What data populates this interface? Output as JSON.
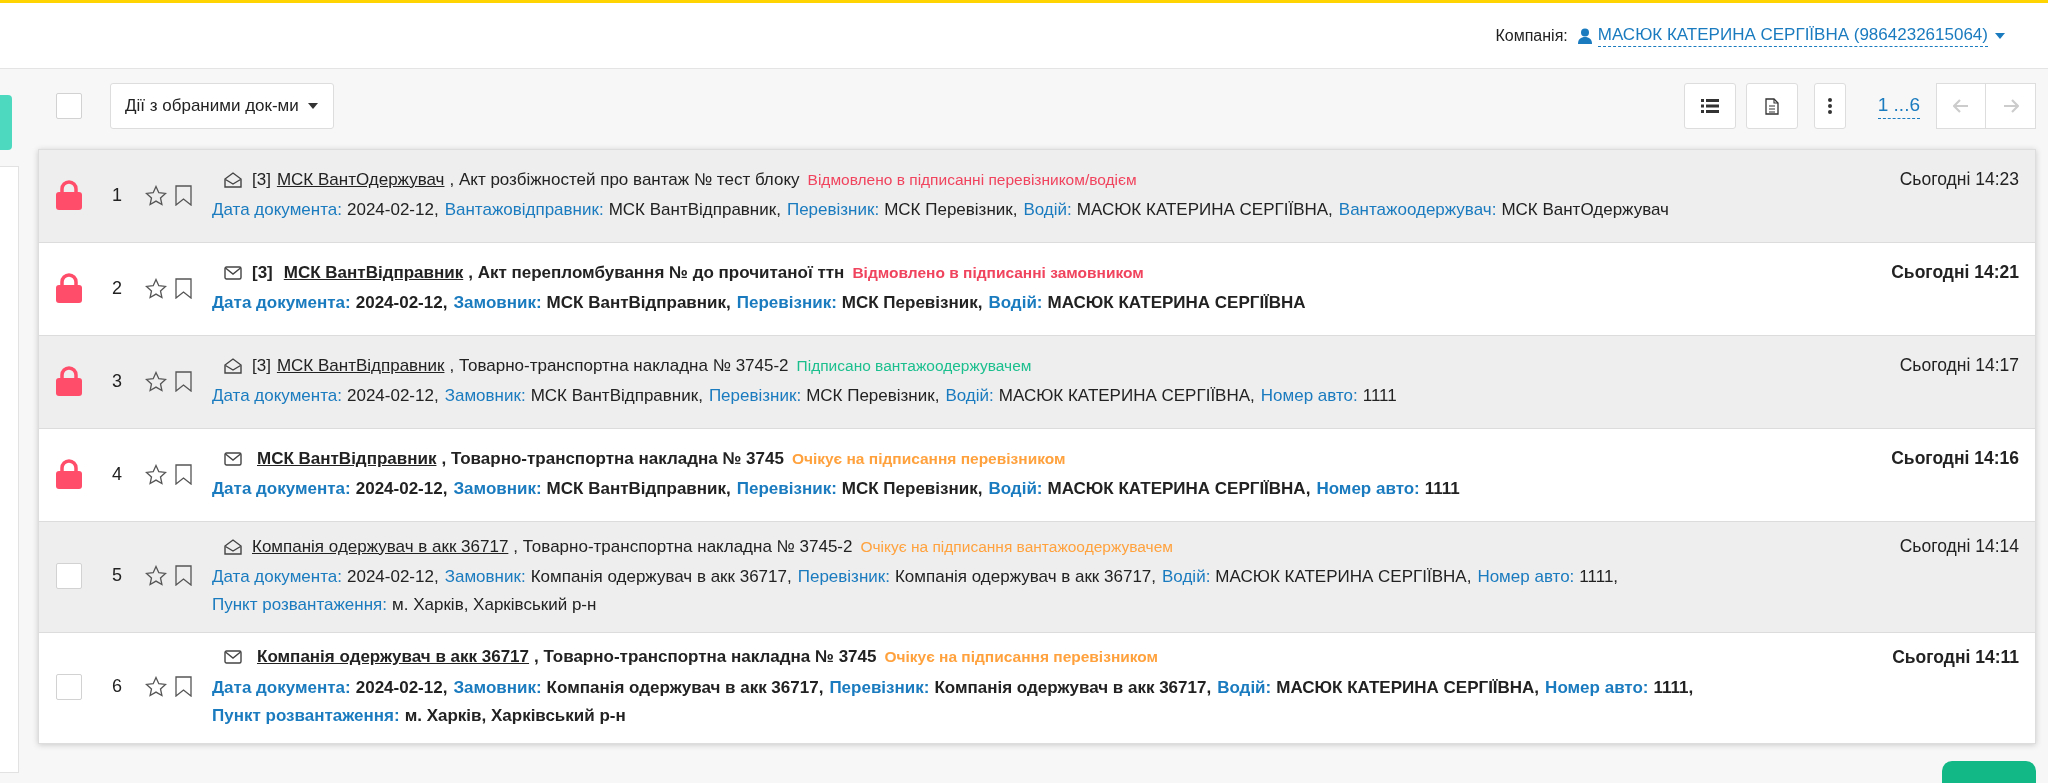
{
  "header": {
    "company_label": "Компанія:",
    "company": "МАСЮК КАТЕРИНА СЕРГІЇВНА (9864232615064)"
  },
  "toolbar": {
    "select_all": {
      "checked": false
    },
    "bulk_actions": "Дії з обраними док-ми",
    "pager": {
      "label": "1 ...6",
      "prev_disabled": true,
      "next_disabled": true
    }
  },
  "documents": [
    {
      "locked": true,
      "number": "1",
      "starred": false,
      "bookmarked": false,
      "unread": false,
      "count": "[3]",
      "sender": "МСК ВантОдержувач",
      "title": ", Акт розбіжностей про вантаж № тест блоку",
      "status": "Відмовлено в підписанні перевізником/водієм",
      "color": "#f0435d",
      "time": "Сьогодні 14:23",
      "fields": [
        {
          "label": "Дата документа:",
          "value": "2024-02-12,"
        },
        {
          "label": "Вантажовідправник:",
          "value": "МСК ВантВідправник,"
        },
        {
          "label": "Перевізник:",
          "value": "МСК Перевізник,"
        },
        {
          "label": "Водій:",
          "value": "МАСЮК КАТЕРИНА СЕРГІЇВНА,"
        },
        {
          "label": "Вантажоодержувач:",
          "value": "МСК ВантОдержувач"
        }
      ]
    },
    {
      "locked": true,
      "number": "2",
      "starred": false,
      "bookmarked": false,
      "unread": true,
      "count": "[3]",
      "sender": "МСК ВантВідправник",
      "title": ", Акт перепломбування № до прочитаної ттн",
      "status": "Відмовлено в підписанні замовником",
      "color": "#f0435d",
      "time": "Сьогодні 14:21",
      "fields": [
        {
          "label": "Дата документа:",
          "value": "2024-02-12,"
        },
        {
          "label": "Замовник:",
          "value": "МСК ВантВідправник,"
        },
        {
          "label": "Перевізник:",
          "value": "МСК Перевізник,"
        },
        {
          "label": "Водій:",
          "value": "МАСЮК КАТЕРИНА СЕРГІЇВНА"
        }
      ]
    },
    {
      "locked": true,
      "number": "3",
      "starred": false,
      "bookmarked": false,
      "unread": false,
      "count": "[3]",
      "sender": "МСК ВантВідправник",
      "title": ", Товарно-транспортна накладна № 3745-2",
      "status": "Підписано вантажоодержувачем",
      "color": "#1bbf8e",
      "time": "Сьогодні 14:17",
      "fields": [
        {
          "label": "Дата документа:",
          "value": "2024-02-12,"
        },
        {
          "label": "Замовник:",
          "value": "МСК ВантВідправник,"
        },
        {
          "label": "Перевізник:",
          "value": "МСК Перевізник,"
        },
        {
          "label": "Водій:",
          "value": "МАСЮК КАТЕРИНА СЕРГІЇВНА,"
        },
        {
          "label": "Номер авто:",
          "value": "1111"
        }
      ]
    },
    {
      "locked": true,
      "number": "4",
      "starred": false,
      "bookmarked": false,
      "unread": true,
      "sender": "МСК ВантВідправник",
      "title": ", Товарно-транспортна накладна № 3745",
      "status": "Очікує на підписання перевізником",
      "color": "#ffa23e",
      "time": "Сьогодні 14:16",
      "fields": [
        {
          "label": "Дата документа:",
          "value": "2024-02-12,"
        },
        {
          "label": "Замовник:",
          "value": "МСК ВантВідправник,"
        },
        {
          "label": "Перевізник:",
          "value": "МСК Перевізник,"
        },
        {
          "label": "Водій:",
          "value": "МАСЮК КАТЕРИНА СЕРГІЇВНА,"
        },
        {
          "label": "Номер авто:",
          "value": "1111"
        }
      ]
    },
    {
      "locked": false,
      "checked": false,
      "number": "5",
      "starred": false,
      "bookmarked": false,
      "unread": false,
      "sender": "Компанія одержувач в акк 36717",
      "title": ", Товарно-транспортна накладна № 3745-2",
      "status": "Очікує на підписання вантажоодержувачем",
      "color": "#ffa23e",
      "time": "Сьогодні 14:14",
      "fields": [
        {
          "label": "Дата документа:",
          "value": "2024-02-12,"
        },
        {
          "label": "Замовник:",
          "value": "Компанія одержувач в акк 36717,"
        },
        {
          "label": "Перевізник:",
          "value": "Компанія одержувач в акк 36717,"
        },
        {
          "label": "Водій:",
          "value": "МАСЮК КАТЕРИНА СЕРГІЇВНА,"
        },
        {
          "label": "Номер авто:",
          "value": "1111,"
        },
        {
          "label": "Пункт розвантаження:",
          "value": "м. Харків, Харківський р-н"
        }
      ]
    },
    {
      "locked": false,
      "checked": false,
      "number": "6",
      "starred": false,
      "bookmarked": false,
      "unread": true,
      "sender": "Компанія одержувач в акк 36717",
      "title": ", Товарно-транспортна накладна № 3745",
      "status": "Очікує на підписання перевізником",
      "color": "#ffa23e",
      "time": "Сьогодні 14:11",
      "fields": [
        {
          "label": "Дата документа:",
          "value": "2024-02-12,"
        },
        {
          "label": "Замовник:",
          "value": "Компанія одержувач в акк 36717,"
        },
        {
          "label": "Перевізник:",
          "value": "Компанія одержувач в акк 36717,"
        },
        {
          "label": "Водій:",
          "value": "МАСЮК КАТЕРИНА СЕРГІЇВНА,"
        },
        {
          "label": "Номер авто:",
          "value": "1111,"
        },
        {
          "label": "Пункт розвантаження:",
          "value": "м. Харків, Харківський р-н"
        }
      ]
    }
  ]
}
